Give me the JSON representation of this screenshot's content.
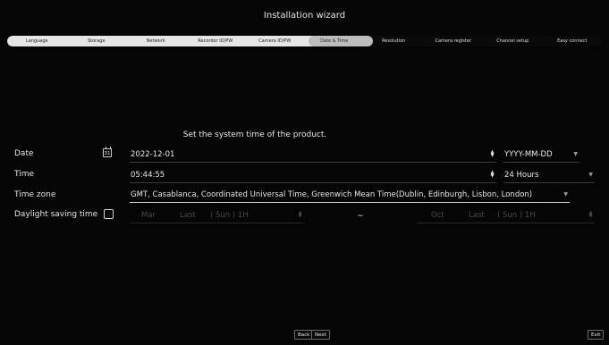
{
  "header": {
    "title": "Installation wizard"
  },
  "steps": [
    {
      "label": "Language"
    },
    {
      "label": "Storage"
    },
    {
      "label": "Network"
    },
    {
      "label": "Recorder ID/PW"
    },
    {
      "label": "Camera ID/PW"
    },
    {
      "label": "Date & Time"
    },
    {
      "label": "Resolution"
    },
    {
      "label": "Camera register"
    },
    {
      "label": "Channel setup"
    },
    {
      "label": "Easy connect"
    }
  ],
  "main": {
    "subtitle": "Set the system time of the product.",
    "date": {
      "label": "Date",
      "calendar_icon_text": "31",
      "value": "2022-12-01",
      "format": "YYYY-MM-DD"
    },
    "time": {
      "label": "Time",
      "value": "05:44:55",
      "format": "24 Hours"
    },
    "timezone": {
      "label": "Time zone",
      "value": "GMT, Casablanca, Coordinated Universal Time, Greenwich Mean Time(Dublin, Edinburgh, Lisbon, London)"
    },
    "dst": {
      "label": "Daylight saving time",
      "checked": false,
      "start": {
        "month": "Mar",
        "week": "Last",
        "day": "( Sun ) 1H"
      },
      "separator": "~",
      "end": {
        "month": "Oct",
        "week": "Last",
        "day": "( Sun ) 1H"
      }
    }
  },
  "footer": {
    "back": "Back",
    "next": "Next",
    "exit": "Exit"
  },
  "colors": {
    "background": "#050505",
    "stepper_done": "#e6e6e6",
    "stepper_current": "#bdbdbd"
  }
}
